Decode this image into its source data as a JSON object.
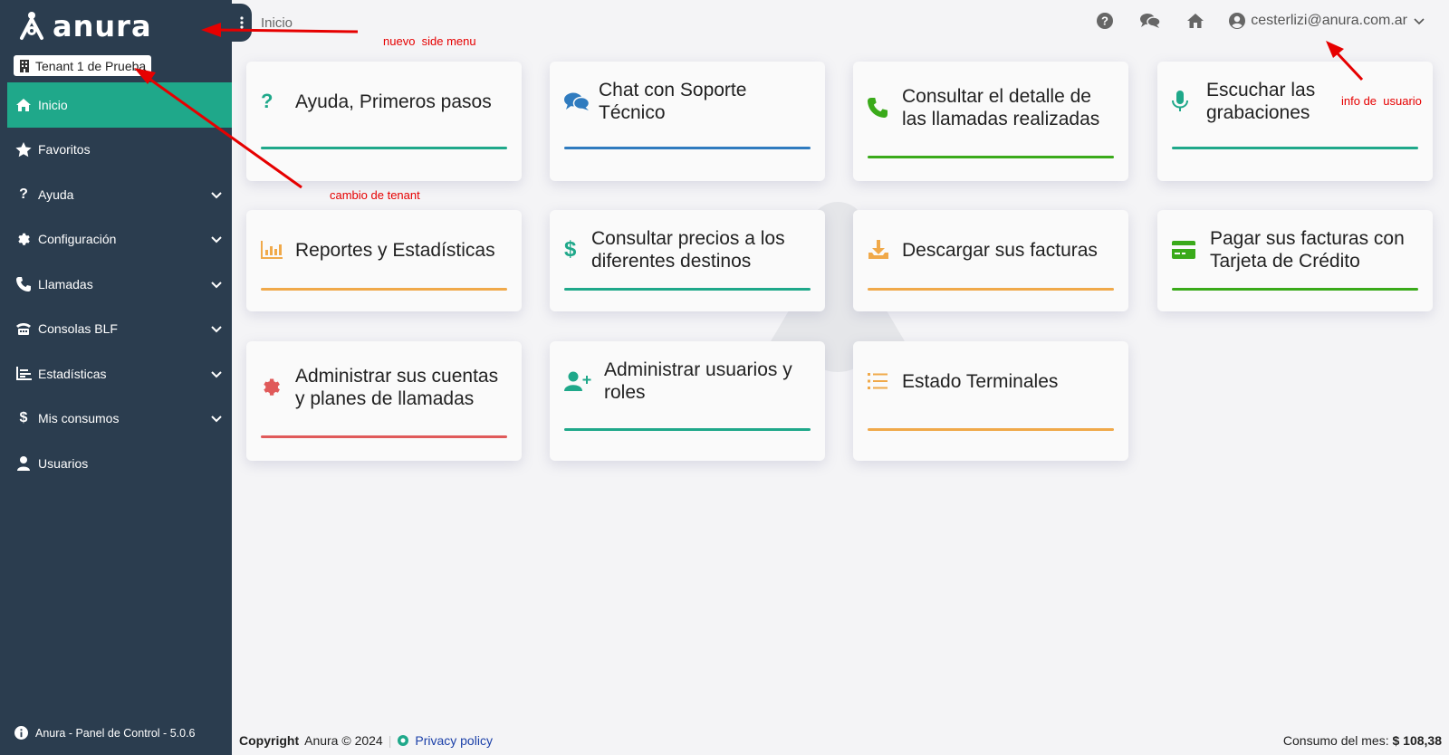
{
  "app": {
    "logo_text": "anura"
  },
  "tenant": {
    "label": "Tenant 1 de Prueba"
  },
  "sidebar": {
    "items": [
      {
        "label": "Inicio",
        "icon": "home-icon",
        "active": true,
        "has_submenu": false
      },
      {
        "label": "Favoritos",
        "icon": "star-icon",
        "active": false,
        "has_submenu": false
      },
      {
        "label": "Ayuda",
        "icon": "question-icon",
        "active": false,
        "has_submenu": true
      },
      {
        "label": "Configuración",
        "icon": "gear-icon",
        "active": false,
        "has_submenu": true
      },
      {
        "label": "Llamadas",
        "icon": "phone-icon",
        "active": false,
        "has_submenu": true
      },
      {
        "label": "Consolas BLF",
        "icon": "console-icon",
        "active": false,
        "has_submenu": true
      },
      {
        "label": "Estadísticas",
        "icon": "chart-icon",
        "active": false,
        "has_submenu": true
      },
      {
        "label": "Mis consumos",
        "icon": "dollar-icon",
        "active": false,
        "has_submenu": true
      },
      {
        "label": "Usuarios",
        "icon": "user-icon",
        "active": false,
        "has_submenu": false
      }
    ],
    "footer": "Anura - Panel de Control - 5.0.6"
  },
  "header": {
    "breadcrumb": "Inicio",
    "user_email": "cesterlizi@anura.com.ar"
  },
  "cards": [
    {
      "title": "Ayuda, Primeros pasos",
      "icon": "question-icon",
      "color": "#1fa88a"
    },
    {
      "title": "Chat con Soporte Técnico",
      "icon": "chat-icon",
      "color": "#2f7bbf"
    },
    {
      "title": "Consultar el detalle de las llamadas realizadas",
      "icon": "phone-icon",
      "color": "#3aaa1a"
    },
    {
      "title": "Escuchar las grabaciones",
      "icon": "microphone-icon",
      "color": "#1fa88a"
    },
    {
      "title": "Reportes y Estadísticas",
      "icon": "bar-chart-icon",
      "color": "#f0a94a"
    },
    {
      "title": "Consultar precios a los diferentes destinos",
      "icon": "dollar-icon",
      "color": "#1fa88a"
    },
    {
      "title": "Descargar sus facturas",
      "icon": "download-icon",
      "color": "#f0a94a"
    },
    {
      "title": "Pagar sus facturas con Tarjeta de Crédito",
      "icon": "credit-card-icon",
      "color": "#3aaa1a"
    },
    {
      "title": "Administrar sus cuentas y planes de llamadas",
      "icon": "gear-icon",
      "color": "#e05a5a"
    },
    {
      "title": "Administrar usuarios y roles",
      "icon": "user-plus-icon",
      "color": "#1fa88a"
    },
    {
      "title": "Estado Terminales",
      "icon": "list-icon",
      "color": "#f0a94a"
    }
  ],
  "annotations": {
    "side_menu": "nuevo  side menu",
    "tenant": "cambio de tenant",
    "user": "info de  usuario",
    "color": "#e60000"
  },
  "footer": {
    "copyright_bold": "Copyright",
    "copyright_rest": "Anura © 2024",
    "privacy": "Privacy policy",
    "consumo_label": "Consumo del mes:",
    "consumo_value": "$ 108,38"
  }
}
